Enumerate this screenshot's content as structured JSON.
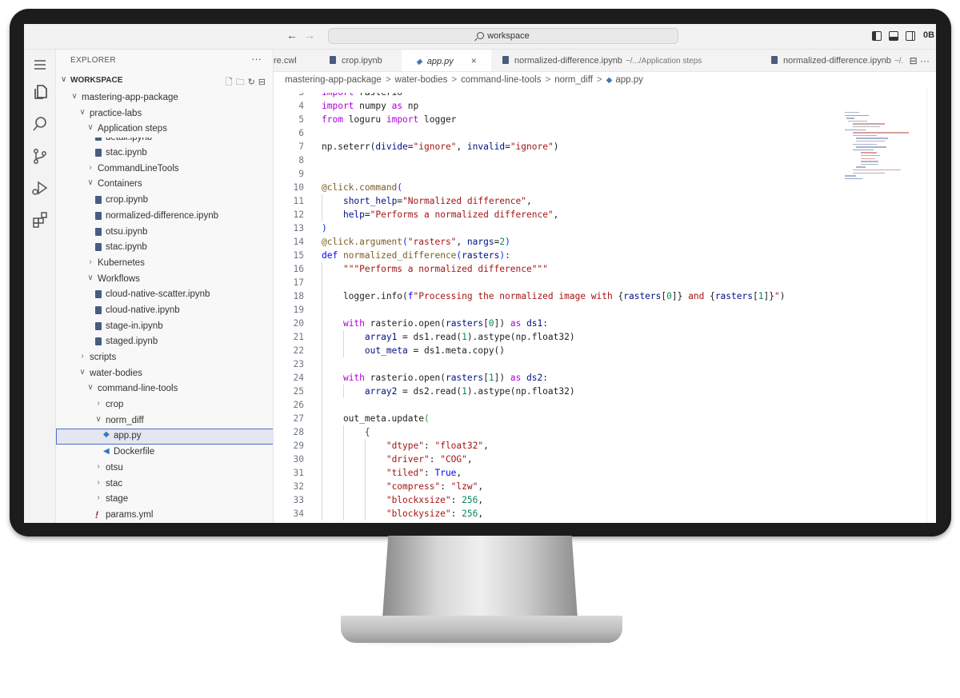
{
  "titlebar": {
    "back": "←",
    "forward": "→",
    "search_text": "workspace",
    "partial_icon_text": "0B"
  },
  "activity_icons": [
    "explorer-icon",
    "search-icon",
    "source-control-icon",
    "run-debug-icon",
    "extensions-icon",
    "menu-icon"
  ],
  "sidebar": {
    "title": "EXPLORER",
    "more": "···",
    "workspace_label": "WORKSPACE",
    "tree": [
      {
        "label": "mastering-app-package",
        "indent": 1,
        "kind": "folder-open"
      },
      {
        "label": "practice-labs",
        "indent": 2,
        "kind": "folder-open"
      },
      {
        "label": "Application steps",
        "indent": 3,
        "kind": "folder-open"
      },
      {
        "label": "detail.ipynb",
        "indent": 4,
        "kind": "notebook",
        "clipped": true
      },
      {
        "label": "stac.ipynb",
        "indent": 4,
        "kind": "notebook"
      },
      {
        "label": "CommandLineTools",
        "indent": 3,
        "kind": "folder"
      },
      {
        "label": "Containers",
        "indent": 3,
        "kind": "folder-open"
      },
      {
        "label": "crop.ipynb",
        "indent": 4,
        "kind": "notebook"
      },
      {
        "label": "normalized-difference.ipynb",
        "indent": 4,
        "kind": "notebook"
      },
      {
        "label": "otsu.ipynb",
        "indent": 4,
        "kind": "notebook"
      },
      {
        "label": "stac.ipynb",
        "indent": 4,
        "kind": "notebook"
      },
      {
        "label": "Kubernetes",
        "indent": 3,
        "kind": "folder"
      },
      {
        "label": "Workflows",
        "indent": 3,
        "kind": "folder-open"
      },
      {
        "label": "cloud-native-scatter.ipynb",
        "indent": 4,
        "kind": "notebook"
      },
      {
        "label": "cloud-native.ipynb",
        "indent": 4,
        "kind": "notebook"
      },
      {
        "label": "stage-in.ipynb",
        "indent": 4,
        "kind": "notebook"
      },
      {
        "label": "staged.ipynb",
        "indent": 4,
        "kind": "notebook"
      },
      {
        "label": "scripts",
        "indent": 2,
        "kind": "folder"
      },
      {
        "label": "water-bodies",
        "indent": 2,
        "kind": "folder-open"
      },
      {
        "label": "command-line-tools",
        "indent": 3,
        "kind": "folder-open"
      },
      {
        "label": "crop",
        "indent": 4,
        "kind": "folder"
      },
      {
        "label": "norm_diff",
        "indent": 4,
        "kind": "folder-open"
      },
      {
        "label": "app.py",
        "indent": 5,
        "kind": "python",
        "selected": true
      },
      {
        "label": "Dockerfile",
        "indent": 5,
        "kind": "docker"
      },
      {
        "label": "otsu",
        "indent": 4,
        "kind": "folder"
      },
      {
        "label": "stac",
        "indent": 4,
        "kind": "folder"
      },
      {
        "label": "stage",
        "indent": 4,
        "kind": "folder"
      },
      {
        "label": "params.yml",
        "indent": 4,
        "kind": "yaml"
      }
    ]
  },
  "tabs": [
    {
      "label": "re.cwl",
      "kind": "plain"
    },
    {
      "label": "crop.ipynb",
      "kind": "notebook"
    },
    {
      "label": "app.py",
      "kind": "python",
      "active": true,
      "close": "×"
    },
    {
      "label": "normalized-difference.ipynb",
      "kind": "notebook",
      "desc": "~/.../Application steps"
    },
    {
      "label": "normalized-difference.ipynb",
      "kind": "notebook",
      "desc": "~/."
    }
  ],
  "tab_actions": "⊟ ···",
  "breadcrumb": [
    "mastering-app-package",
    "water-bodies",
    "command-line-tools",
    "norm_diff",
    "app.py"
  ],
  "editor": {
    "lines": [
      {
        "n": "3",
        "html": "<span class='kwc'>import</span> rasterio",
        "clipped": true
      },
      {
        "n": "4",
        "html": "<span class='kwc'>import</span> numpy <span class='kwc'>as</span> np"
      },
      {
        "n": "5",
        "html": "<span class='kwc'>from</span> loguru <span class='kwc'>import</span> logger"
      },
      {
        "n": "6",
        "html": ""
      },
      {
        "n": "7",
        "html": "np.seterr(<span class='var'>divide</span>=<span class='str'>\"ignore\"</span>, <span class='var'>invalid</span>=<span class='str'>\"ignore\"</span>)"
      },
      {
        "n": "8",
        "html": ""
      },
      {
        "n": "9",
        "html": ""
      },
      {
        "n": "10",
        "html": "<span class='dec'>@click.command</span><span class='br'>(</span>"
      },
      {
        "n": "11",
        "html": "    <span class='var'>short_help</span>=<span class='str'>\"Normalized difference\"</span>,",
        "g": [
          1
        ]
      },
      {
        "n": "12",
        "html": "    <span class='var'>help</span>=<span class='str'>\"Performs a normalized difference\"</span>,",
        "g": [
          1
        ]
      },
      {
        "n": "13",
        "html": "<span class='br'>)</span>"
      },
      {
        "n": "14",
        "html": "<span class='dec'>@click.argument</span><span class='br'>(</span><span class='str'>\"rasters\"</span>, <span class='var'>nargs</span>=<span class='num2'>2</span><span class='br'>)</span>"
      },
      {
        "n": "15",
        "html": "<span class='kw'>def</span> <span class='fn'>normalized_difference</span><span class='br'>(</span><span class='var'>rasters</span><span class='br'>)</span>:"
      },
      {
        "n": "16",
        "html": "    <span class='str'>\"\"\"Performs a normalized difference\"\"\"</span>",
        "g": [
          1
        ]
      },
      {
        "n": "17",
        "html": "",
        "g": [
          1
        ]
      },
      {
        "n": "18",
        "html": "    logger.info(<span class='kw'>f</span><span class='str'>\"Processing the normalized image with </span>{<span class='var'>rasters</span>[<span class='num2'>0</span>]}<span class='str'> and </span>{<span class='var'>rasters</span>[<span class='num2'>1</span>]}<span class='str'>\"</span>)",
        "g": [
          1
        ]
      },
      {
        "n": "19",
        "html": "",
        "g": [
          1
        ]
      },
      {
        "n": "20",
        "html": "    <span class='kwc'>with</span> rasterio.open(<span class='var'>rasters</span>[<span class='num2'>0</span>]) <span class='kwc'>as</span> <span class='var'>ds1</span>:",
        "g": [
          1
        ]
      },
      {
        "n": "21",
        "html": "        <span class='var'>array1</span> = ds1.read(<span class='num2'>1</span>).astype(np.float32)",
        "g": [
          1,
          2
        ]
      },
      {
        "n": "22",
        "html": "        <span class='var'>out_meta</span> = ds1.meta.copy()",
        "g": [
          1,
          2
        ]
      },
      {
        "n": "23",
        "html": "",
        "g": [
          1
        ]
      },
      {
        "n": "24",
        "html": "    <span class='kwc'>with</span> rasterio.open(<span class='var'>rasters</span>[<span class='num2'>1</span>]) <span class='kwc'>as</span> <span class='var'>ds2</span>:",
        "g": [
          1
        ]
      },
      {
        "n": "25",
        "html": "        <span class='var'>array2</span> = ds2.read(<span class='num2'>1</span>).astype(np.float32)",
        "g": [
          1,
          2
        ]
      },
      {
        "n": "26",
        "html": "",
        "g": [
          1
        ]
      },
      {
        "n": "27",
        "html": "    out_meta.update<span class='br2'>(</span>",
        "g": [
          1
        ]
      },
      {
        "n": "28",
        "html": "        <span class='br3'>{</span>",
        "g": [
          1,
          2
        ]
      },
      {
        "n": "29",
        "html": "            <span class='str'>\"dtype\"</span>: <span class='str'>\"float32\"</span>,",
        "g": [
          1,
          2,
          3
        ]
      },
      {
        "n": "30",
        "html": "            <span class='str'>\"driver\"</span>: <span class='str'>\"COG\"</span>,",
        "g": [
          1,
          2,
          3
        ]
      },
      {
        "n": "31",
        "html": "            <span class='str'>\"tiled\"</span>: <span class='kw'>True</span>,",
        "g": [
          1,
          2,
          3
        ]
      },
      {
        "n": "32",
        "html": "            <span class='str'>\"compress\"</span>: <span class='str'>\"lzw\"</span>,",
        "g": [
          1,
          2,
          3
        ]
      },
      {
        "n": "33",
        "html": "            <span class='str'>\"blockxsize\"</span>: <span class='num2'>256</span>,",
        "g": [
          1,
          2,
          3
        ]
      },
      {
        "n": "34",
        "html": "            <span class='str'>\"blockysize\"</span>: <span class='num2'>256</span>,",
        "g": [
          1,
          2,
          3
        ]
      }
    ]
  }
}
